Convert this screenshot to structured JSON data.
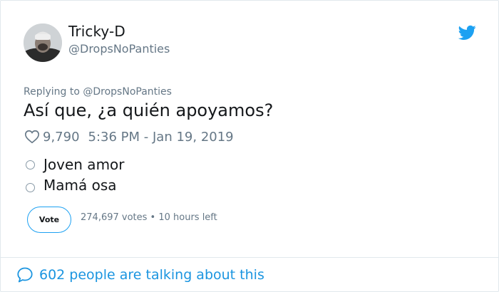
{
  "author": {
    "name": "Tricky-D",
    "handle": "@DropsNoPanties"
  },
  "tweet": {
    "replying_to": "Replying to @DropsNoPanties",
    "text": "Así que, ¿a quién apoyamos?",
    "likes": "9,790",
    "timestamp": "5:36 PM - Jan 19, 2019"
  },
  "poll": {
    "options": [
      {
        "label": "Joven amor"
      },
      {
        "label": "Mamá osa"
      }
    ],
    "vote_label": "Vote",
    "status": "274,697 votes • 10 hours left"
  },
  "footer": {
    "talking_text": "602 people are talking about this"
  },
  "colors": {
    "brand_blue": "#1da1f2",
    "link_blue": "#1b95e0",
    "muted_gray": "#657786",
    "text": "#14171a"
  },
  "icons": [
    "twitter-bird-icon",
    "heart-icon",
    "speech-bubble-icon"
  ]
}
